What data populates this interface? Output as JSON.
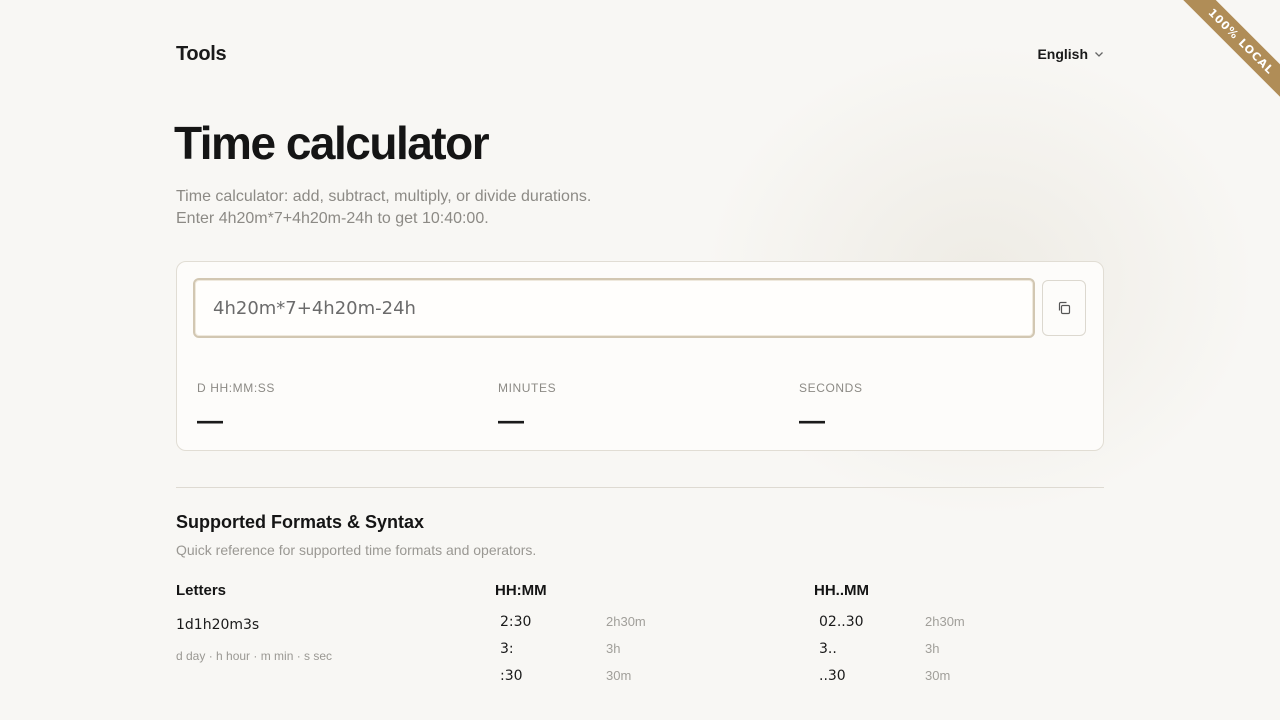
{
  "header": {
    "brand": "Tools",
    "language": "English"
  },
  "ribbon": "100% LOCAL",
  "page": {
    "title": "Time calculator",
    "description_line1": "Time calculator: add, subtract, multiply, or divide durations.",
    "description_line2": "Enter 4h20m*7+4h20m-24h to get 10:40:00."
  },
  "calculator": {
    "expression": "4h20m*7+4h20m-24h",
    "results": [
      {
        "label": "D HH:MM:SS",
        "value": "—"
      },
      {
        "label": "MINUTES",
        "value": "—"
      },
      {
        "label": "SECONDS",
        "value": "—"
      }
    ]
  },
  "reference": {
    "title": "Supported Formats & Syntax",
    "description": "Quick reference for supported time formats and operators.",
    "letters": {
      "title": "Letters",
      "example": "1d1h20m3s",
      "note": "d day · h hour · m min · s sec"
    },
    "hhmm": {
      "title": "HH:MM",
      "rows": [
        {
          "input": "2:30",
          "meaning": "2h30m"
        },
        {
          "input": "3:",
          "meaning": "3h"
        },
        {
          "input": ":30",
          "meaning": "30m"
        }
      ]
    },
    "hhdotmm": {
      "title": "HH..MM",
      "rows": [
        {
          "input": "02..30",
          "meaning": "2h30m"
        },
        {
          "input": "3..",
          "meaning": "3h"
        },
        {
          "input": "..30",
          "meaning": "30m"
        }
      ]
    }
  },
  "colors": {
    "accent": "#b08d57",
    "background": "#f8f7f4",
    "input_border": "#d2c7b2"
  }
}
